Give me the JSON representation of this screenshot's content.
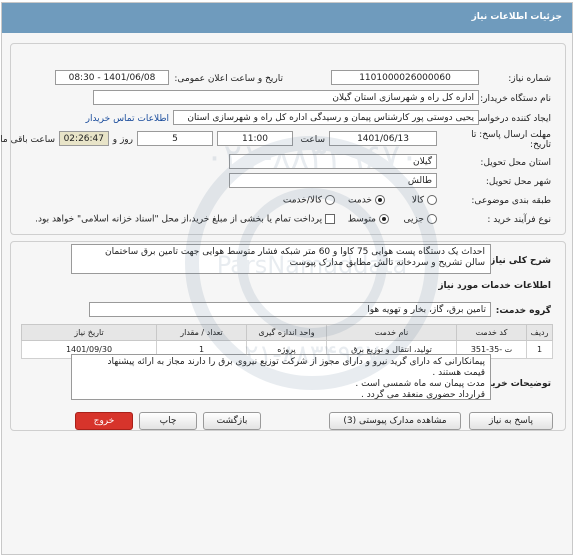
{
  "header": {
    "title": "جزئیات اطلاعات نیاز"
  },
  "form": {
    "need_number_label": "شماره نیاز:",
    "need_number": "1101000026000060",
    "announce_label": "تاریخ و ساعت اعلان عمومی:",
    "announce_value": "1401/06/08 - 08:30",
    "buyer_org_label": "نام دستگاه خریدار:",
    "buyer_org": "اداره کل راه و شهرسازی استان گیلان",
    "creator_label": "ایجاد کننده درخواست:",
    "creator": "یحیی دوستی پور کارشناس پیمان و رسیدگی اداره کل راه و شهرسازی استان",
    "contact_link": "اطلاعات تماس خریدار",
    "deadline_label_1": "مهلت ارسال پاسخ: تا",
    "deadline_label_2": "تاریخ:",
    "deadline_date": "1401/06/13",
    "time_label": "ساعت",
    "deadline_time": "11:00",
    "days_value": "5",
    "days_label": "روز و",
    "remaining_time": "02:26:47",
    "remaining_label": "ساعت باقی مانده",
    "province_label": "استان محل تحویل:",
    "province": "گیلان",
    "city_label": "شهر محل تحویل:",
    "city": "طالش",
    "category_label": "طبقه بندی موضوعی:",
    "category_options": [
      "کالا",
      "خدمت",
      "کالا/خدمت"
    ],
    "category_selected": "خدمت",
    "process_label": "نوع فرآیند خرید :",
    "process_options": [
      "جزیی",
      "متوسط"
    ],
    "process_selected": "متوسط",
    "payment_note": "پرداخت تمام یا بخشی از مبلغ خرید،از محل \"اسناد خزانه اسلامی\" خواهد بود."
  },
  "description": {
    "label": "شرح کلی نیاز:",
    "text_line1": "احداث یک دستگاه پست هوایی 75 کاوا و 60 متر شبکه فشار متوسط هوایی جهت تامین برق ساختمان",
    "text_line2": "سالن تشریح و سردخانه تالش مطابق مدارک پیوست"
  },
  "services": {
    "section_title": "اطلاعات خدمات مورد نیاز",
    "group_label": "گروه خدمت:",
    "group_value": "تامین برق، گاز، بخار و تهویه هوا",
    "columns": [
      "ردیف",
      "کد خدمت",
      "نام خدمت",
      "واحد اندازه گیری",
      "تعداد / مقدار",
      "تاریخ نیاز"
    ],
    "rows": [
      [
        "1",
        "ت -35-351",
        "تولید، انتقال و توزیع برق",
        "پروژه",
        "1",
        "1401/09/30"
      ]
    ]
  },
  "notes": {
    "label": "توضیحات خریدار:",
    "lines": [
      "پیمانکارانی که دارای گرید نیرو و دارای مجوز از شرکت توزیع نیروی برق را دارند مجاز به ارائه پیشنهاد",
      "قیمت هستند .",
      "مدت پیمان سه ماه شمسی است .",
      "قرارداد حضوری منعقد می گردد ."
    ]
  },
  "buttons": {
    "reply": "پاسخ به نیاز",
    "attachments": "مشاهده مدارک پیوستی (3)",
    "back": "بازگشت",
    "print": "چاپ",
    "exit": "خروج"
  },
  "watermark": {
    "number_text": "۰۲۱-۸۸۳۴۹۶۷۰",
    "brand": "ParsNamaddata",
    "phone": "۰۲۱-۸۸۳۴۹۶۷۰"
  }
}
